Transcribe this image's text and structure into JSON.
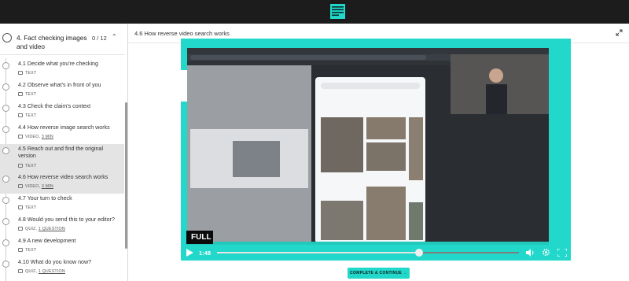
{
  "brand": {
    "logo_icon": "bellingcat-logo-icon",
    "topbar_color": "#1c1c1c",
    "accent_color": "#21d8ca"
  },
  "sidebar": {
    "section": {
      "title": "4. Fact checking images and video",
      "progress": "0 / 12",
      "chevron_icon": "chevron-up-icon"
    },
    "lessons": [
      {
        "title": "4.1 Decide what you're checking",
        "type": "TEXT",
        "duration": "",
        "icon": "text-doc-icon",
        "active": false
      },
      {
        "title": "4.2 Observe what's in front of you",
        "type": "TEXT",
        "duration": "",
        "icon": "text-doc-icon",
        "active": false
      },
      {
        "title": "4.3 Check the claim's context",
        "type": "TEXT",
        "duration": "",
        "icon": "text-doc-icon",
        "active": false
      },
      {
        "title": "4.4 How reverse image search works",
        "type": "VIDEO",
        "duration": "3 MIN",
        "icon": "video-icon",
        "active": false
      },
      {
        "title": "4.5 Reach out and find the original version",
        "type": "TEXT",
        "duration": "",
        "icon": "text-doc-icon",
        "active": true
      },
      {
        "title": "4.6 How reverse video search works",
        "type": "VIDEO",
        "duration": "3 MIN",
        "icon": "video-icon",
        "active": true
      },
      {
        "title": "4.7 Your turn to check",
        "type": "TEXT",
        "duration": "",
        "icon": "text-doc-icon",
        "active": false
      },
      {
        "title": "4.8 Would you send this to your editor?",
        "type": "QUIZ",
        "duration": "1 QUESTION",
        "icon": "quiz-icon",
        "active": false
      },
      {
        "title": "4.9 A new development",
        "type": "TEXT",
        "duration": "",
        "icon": "text-doc-icon",
        "active": false
      },
      {
        "title": "4.10 What do you know now?",
        "type": "QUIZ",
        "duration": "1 QUESTION",
        "icon": "quiz-icon",
        "active": false
      }
    ]
  },
  "main": {
    "lesson_title": "4.6 How reverse video search works",
    "expand_icon": "expand-icon",
    "video": {
      "badge_label": "FULL",
      "current_time": "1:48",
      "progress": 0.67,
      "controls": {
        "play": "play-icon",
        "volume": "volume-icon",
        "settings": "gear-icon",
        "fullscreen": "fullscreen-icon"
      }
    },
    "complete_button_label": "COMPLETE & CONTINUE →"
  }
}
